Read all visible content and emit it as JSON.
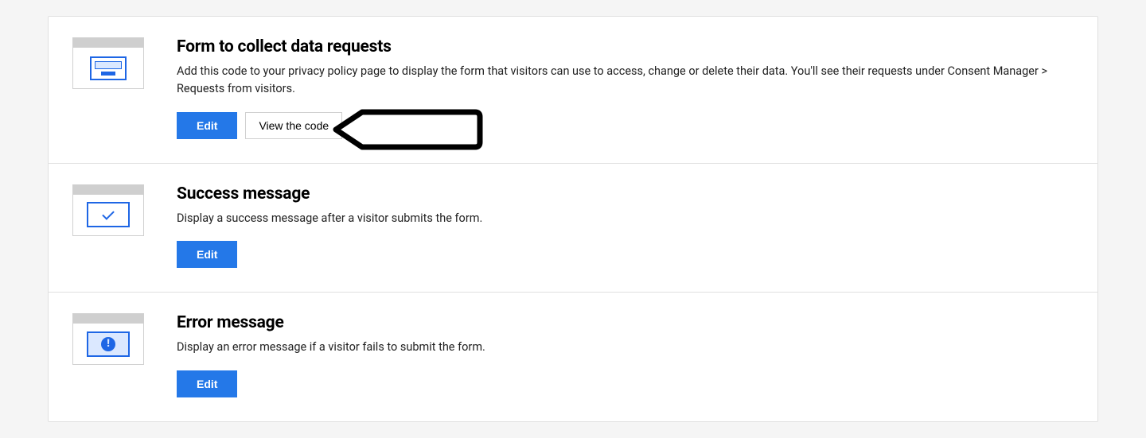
{
  "rows": [
    {
      "title": "Form to collect data requests",
      "description": "Add this code to your privacy policy page to display the form that visitors can use to access, change or delete their data. You'll see their requests under Consent Manager > Requests from visitors.",
      "edit_label": "Edit",
      "view_code_label": "View the code"
    },
    {
      "title": "Success message",
      "description": "Display a success message after a visitor submits the form.",
      "edit_label": "Edit"
    },
    {
      "title": "Error message",
      "description": "Display an error message if a visitor fails to submit the form.",
      "edit_label": "Edit"
    }
  ]
}
